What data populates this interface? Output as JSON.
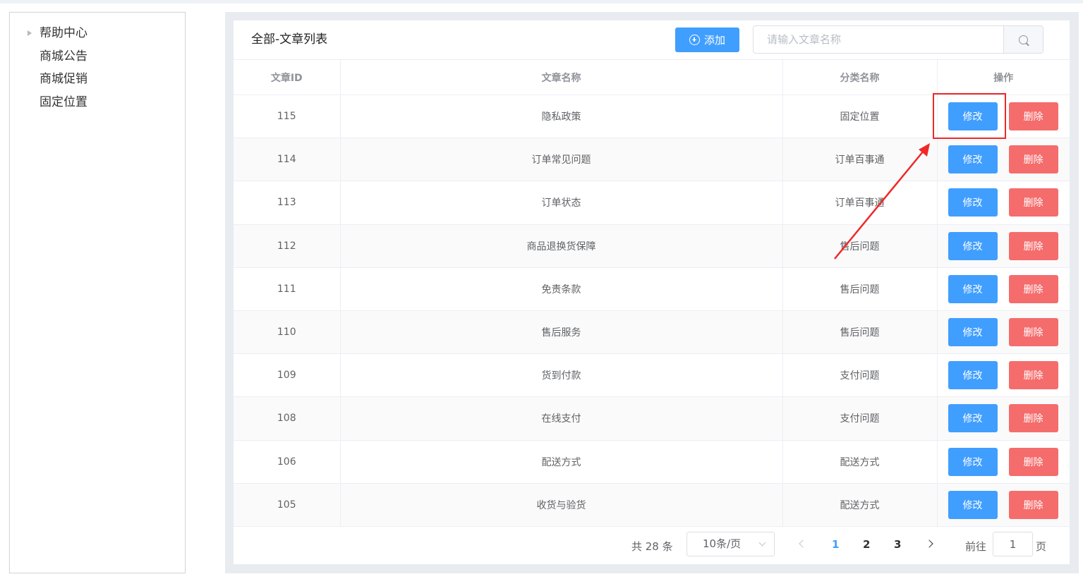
{
  "sidebar": {
    "items": [
      {
        "label": "帮助中心"
      },
      {
        "label": "商城公告"
      },
      {
        "label": "商城促销"
      },
      {
        "label": "固定位置"
      }
    ]
  },
  "header": {
    "title": "全部-文章列表",
    "add_label": "添加",
    "search_placeholder": "请输入文章名称"
  },
  "table": {
    "columns": [
      "文章ID",
      "文章名称",
      "分类名称",
      "操作"
    ],
    "edit_label": "修改",
    "delete_label": "删除",
    "rows": [
      {
        "id": "115",
        "name": "隐私政策",
        "category": "固定位置"
      },
      {
        "id": "114",
        "name": "订单常见问题",
        "category": "订单百事通"
      },
      {
        "id": "113",
        "name": "订单状态",
        "category": "订单百事通"
      },
      {
        "id": "112",
        "name": "商品退换货保障",
        "category": "售后问题"
      },
      {
        "id": "111",
        "name": "免责条款",
        "category": "售后问题"
      },
      {
        "id": "110",
        "name": "售后服务",
        "category": "售后问题"
      },
      {
        "id": "109",
        "name": "货到付款",
        "category": "支付问题"
      },
      {
        "id": "108",
        "name": "在线支付",
        "category": "支付问题"
      },
      {
        "id": "106",
        "name": "配送方式",
        "category": "配送方式"
      },
      {
        "id": "105",
        "name": "收货与验货",
        "category": "配送方式"
      }
    ]
  },
  "pagination": {
    "total": "共 28 条",
    "page_size": "10条/页",
    "pages": [
      "1",
      "2",
      "3"
    ],
    "current_page": "1",
    "goto_label": "前往",
    "goto_value": "1",
    "unit": "页"
  },
  "colors": {
    "primary": "#409eff",
    "danger": "#f56c6c",
    "annotation": "#f02828"
  }
}
